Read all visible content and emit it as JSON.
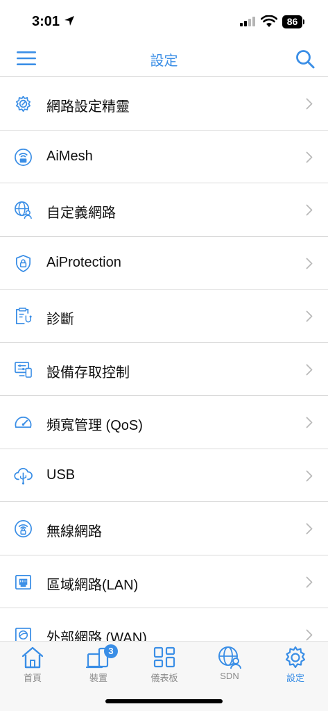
{
  "status": {
    "time": "3:01",
    "battery": "86"
  },
  "nav": {
    "title": "設定",
    "left_icon": "hamburger-menu-icon",
    "right_icon": "search-icon"
  },
  "accent_color": "#3a8ee6",
  "settings_items": [
    {
      "label": "網路設定精靈",
      "icon": "gear-wand-icon"
    },
    {
      "label": "AiMesh",
      "icon": "aimesh-router-icon"
    },
    {
      "label": "自定義網路",
      "icon": "globe-user-icon"
    },
    {
      "label": "AiProtection",
      "icon": "shield-lock-icon"
    },
    {
      "label": "診斷",
      "icon": "clipboard-stethoscope-icon"
    },
    {
      "label": "設備存取控制",
      "icon": "monitor-device-icon"
    },
    {
      "label": "頻寬管理 (QoS)",
      "icon": "speedometer-icon"
    },
    {
      "label": "USB",
      "icon": "cloud-usb-icon"
    },
    {
      "label": "無線網路",
      "icon": "wifi-lock-icon"
    },
    {
      "label": "區域網路(LAN)",
      "icon": "lan-port-icon"
    },
    {
      "label": "外部網路 (WAN)",
      "icon": "wan-globe-icon"
    }
  ],
  "tabs": [
    {
      "label": "首頁",
      "icon": "home-icon",
      "active": false
    },
    {
      "label": "裝置",
      "icon": "devices-icon",
      "active": false,
      "badge": "3"
    },
    {
      "label": "儀表板",
      "icon": "dashboard-grid-icon",
      "active": false
    },
    {
      "label": "SDN",
      "icon": "sdn-globe-user-icon",
      "active": false
    },
    {
      "label": "設定",
      "icon": "settings-gear-icon",
      "active": true
    }
  ]
}
